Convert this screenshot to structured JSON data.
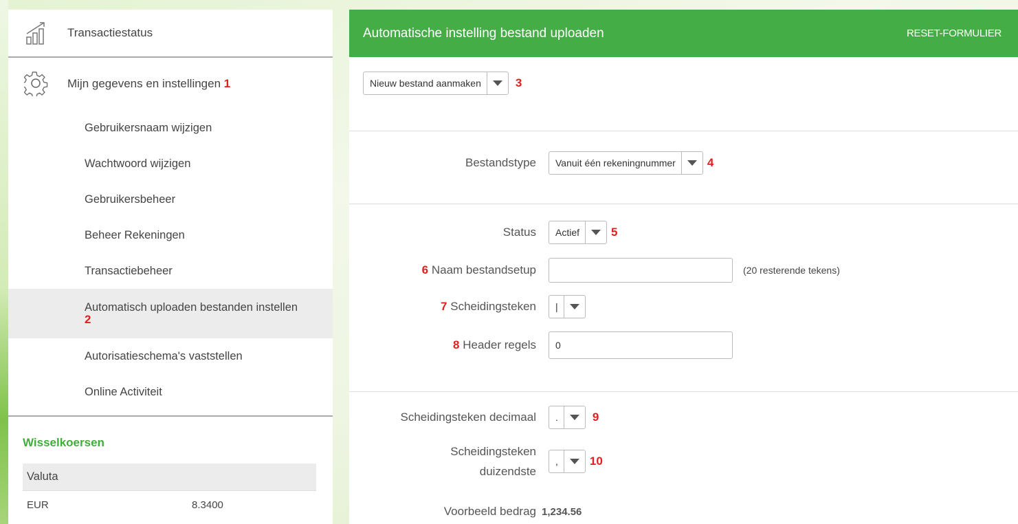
{
  "sidebar": {
    "top_label": "Transactiestatus",
    "settings_label": "Mijn gegevens en instellingen",
    "settings_badge": "1",
    "items": [
      {
        "label": "Gebruikersnaam wijzigen"
      },
      {
        "label": "Wachtwoord wijzigen"
      },
      {
        "label": "Gebruikersbeheer"
      },
      {
        "label": "Beheer Rekeningen"
      },
      {
        "label": "Transactiebeheer"
      },
      {
        "label": "Automatisch uploaden bestanden instellen",
        "badge": "2"
      },
      {
        "label": "Autorisatieschema's vaststellen"
      },
      {
        "label": "Online Activiteit"
      }
    ],
    "rates_title": "Wisselkoersen",
    "rates_header": "Valuta",
    "rates": [
      {
        "currency": "EUR",
        "value": "8.3400"
      }
    ]
  },
  "main": {
    "title": "Automatische instelling bestand uploaden",
    "reset": "RESET-FORMULIER",
    "setup_select": {
      "value": "Nieuw bestand aanmaken",
      "badge": "3"
    },
    "filetype": {
      "label": "Bestandstype",
      "value": "Vanuit één rekeningnummer",
      "badge": "4"
    },
    "status": {
      "label": "Status",
      "value": "Actief",
      "badge": "5"
    },
    "name": {
      "label": "Naam bestandsetup",
      "badge": "6",
      "value": "",
      "hint": "(20 resterende tekens)"
    },
    "separator": {
      "label": "Scheidingsteken",
      "badge": "7",
      "value": "|"
    },
    "header_rows": {
      "label": "Header regels",
      "badge": "8",
      "value": "0"
    },
    "decimal": {
      "label": "Scheidingsteken decimaal",
      "value": ".",
      "badge": "9"
    },
    "thousands": {
      "label_line1": "Scheidingsteken",
      "label_line2": "duizendste",
      "value": ",",
      "badge": "10"
    },
    "example": {
      "label": "Voorbeeld bedrag",
      "value": "1,234.56"
    }
  },
  "colors": {
    "accent_green": "#44ad46",
    "badge_red": "#e02020",
    "rates_green": "#3fae3a"
  }
}
